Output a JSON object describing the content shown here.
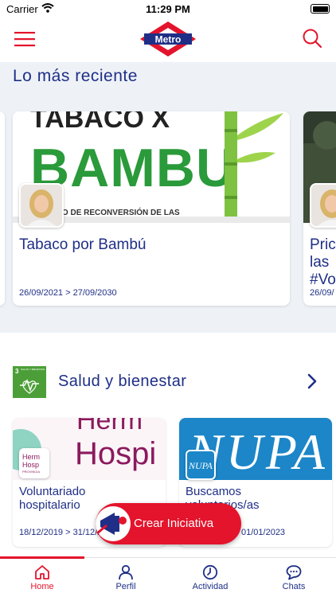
{
  "status_bar": {
    "carrier": "Carrier",
    "time": "11:29 PM"
  },
  "header": {
    "logo_text": "Metro"
  },
  "recent": {
    "title": "Lo más reciente",
    "cards": [
      {
        "image_text_top": "TABACO X",
        "image_text_main": "BAMBU",
        "image_text_sub": "TO DE RECONVERSIÓN DE LAS",
        "title": "Tabaco por Bambú",
        "dates": "26/09/2021 > 27/09/2030"
      },
      {
        "title_lines": [
          "Pric",
          "las",
          "#Vo"
        ],
        "dates": "26/09/"
      }
    ]
  },
  "health": {
    "category_title": "Salud y bienestar",
    "ods_number": "3",
    "ods_text": "SALUD Y BIENESTAR",
    "cards": [
      {
        "image_text_top": "Herm",
        "image_text_main": "Hospi",
        "avatar_text_1": "Herm",
        "avatar_text_2": "Hosp",
        "avatar_text_3": "PROVINCIA",
        "title_line1": "Voluntariado",
        "title_line2": "hospitalario",
        "dates": "18/12/2019 > 31/12/2"
      },
      {
        "image_text": "NUPA",
        "avatar_text": "NUPA",
        "title_line1": "Buscamos",
        "title_line2": "voluntarios/as",
        "dates": "01/01/2023"
      }
    ]
  },
  "fab": {
    "label": "Crear Iniciativa"
  },
  "tabs": [
    {
      "label": "Home",
      "icon": "home-icon",
      "active": true
    },
    {
      "label": "Perfil",
      "icon": "person-icon",
      "active": false
    },
    {
      "label": "Actividad",
      "icon": "clock-icon",
      "active": false
    },
    {
      "label": "Chats",
      "icon": "chat-icon",
      "active": false
    }
  ],
  "colors": {
    "brand_red": "#e3142c",
    "brand_blue": "#1f2f87",
    "ods_green": "#4c9f38"
  }
}
